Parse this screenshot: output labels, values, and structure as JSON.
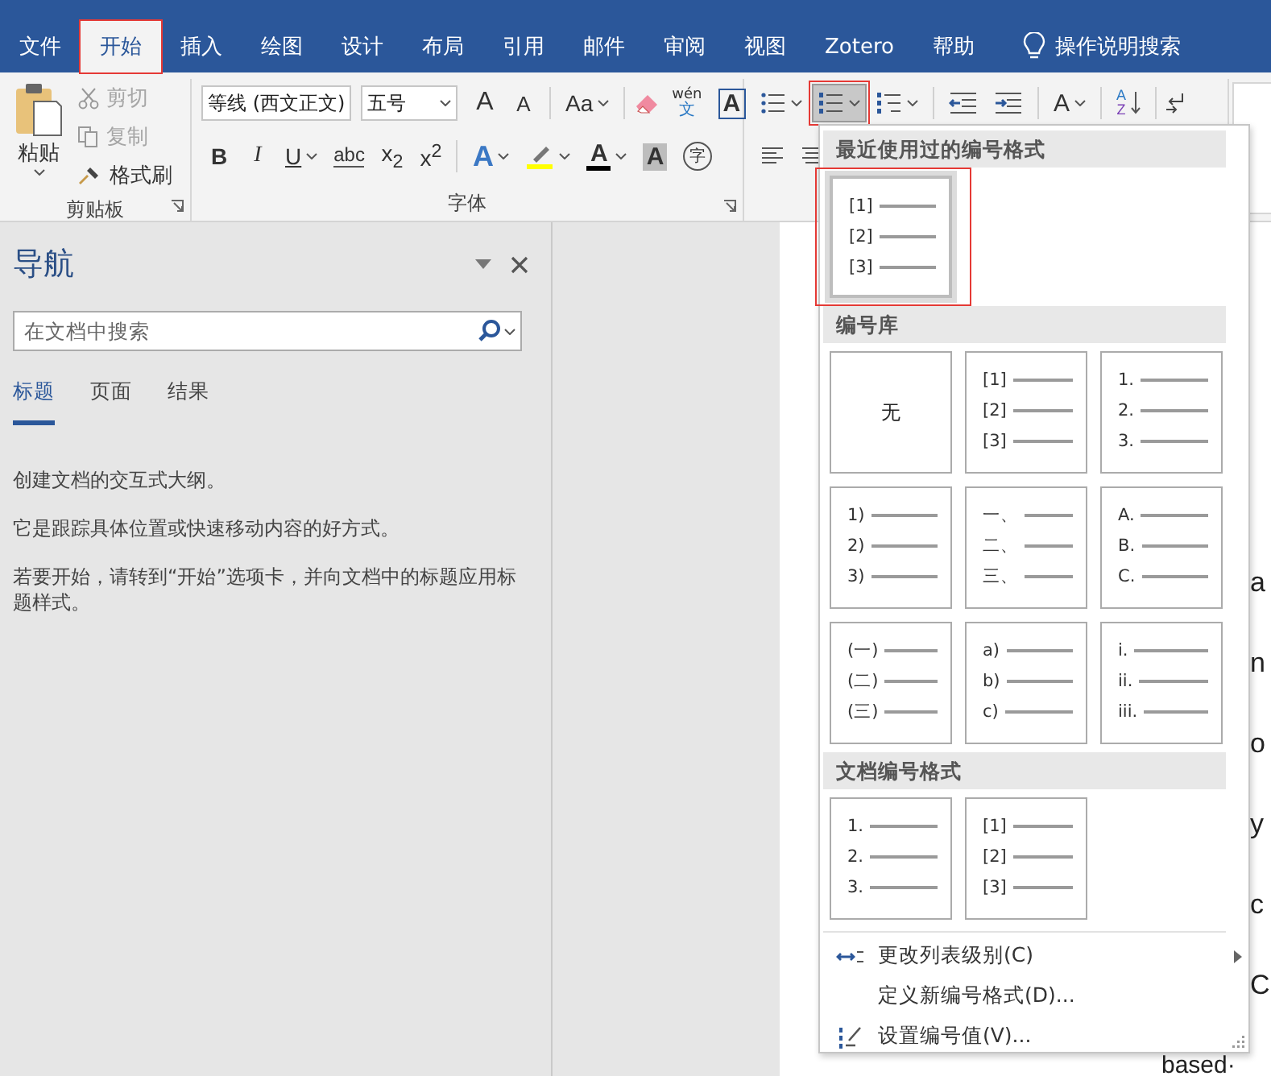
{
  "tabs": [
    {
      "label": "文件",
      "selected": false,
      "highlighted": false
    },
    {
      "label": "开始",
      "selected": true,
      "highlighted": true
    },
    {
      "label": "插入",
      "selected": false,
      "highlighted": false
    },
    {
      "label": "绘图",
      "selected": false,
      "highlighted": false
    },
    {
      "label": "设计",
      "selected": false,
      "highlighted": false
    },
    {
      "label": "布局",
      "selected": false,
      "highlighted": false
    },
    {
      "label": "引用",
      "selected": false,
      "highlighted": false
    },
    {
      "label": "邮件",
      "selected": false,
      "highlighted": false
    },
    {
      "label": "审阅",
      "selected": false,
      "highlighted": false
    },
    {
      "label": "视图",
      "selected": false,
      "highlighted": false
    },
    {
      "label": "Zotero",
      "selected": false,
      "highlighted": false
    },
    {
      "label": "帮助",
      "selected": false,
      "highlighted": false
    }
  ],
  "tell_me": "操作说明搜索",
  "clipboard": {
    "paste": "粘贴",
    "group_label": "剪贴板",
    "commands": [
      {
        "label": "剪切",
        "disabled": true
      },
      {
        "label": "复制",
        "disabled": true
      },
      {
        "label": "格式刷",
        "disabled": false
      }
    ]
  },
  "font": {
    "face": "等线 (西文正文)",
    "size": "五号",
    "grow": "A",
    "shrink": "A",
    "change_case": "Aa",
    "phonetic_top": "wén",
    "phonetic_bottom": "文",
    "char_border": "A",
    "format_buttons": [
      {
        "label": "B",
        "kind": "bold"
      },
      {
        "label": "I",
        "kind": "italic"
      },
      {
        "label": "U",
        "kind": "underline"
      },
      {
        "label": "abc",
        "kind": "strike"
      },
      {
        "label": "x$_{2}$",
        "kind": "plain"
      },
      {
        "label": "x$^{2}$",
        "kind": "plain"
      }
    ],
    "text_effects": "A",
    "font_color": "A",
    "char_shading": "A",
    "enclose_char": "字",
    "group_label": "字体"
  },
  "paragraph": {
    "numbering_pressed": true,
    "numbering_highlighted": true,
    "asian_layout": "A",
    "sort_top": "A",
    "sort_bottom": "Z"
  },
  "navigation": {
    "title": "导航",
    "search_placeholder": "在文档中搜索",
    "tabs": [
      {
        "label": "标题",
        "selected": true
      },
      {
        "label": "页面",
        "selected": false
      },
      {
        "label": "结果",
        "selected": false
      }
    ],
    "paragraphs": [
      "创建文档的交互式大纲。",
      "它是跟踪具体位置或快速移动内容的好方式。",
      "若要开始，请转到“开始”选项卡，并向文档中的标题应用标题样式。"
    ]
  },
  "document_lines": [
    {
      "text": "a",
      "kind": "fragment"
    },
    {
      "text": "n",
      "kind": "fragment"
    },
    {
      "text": "o",
      "kind": "fragment"
    },
    {
      "text": "y",
      "kind": "fragment"
    },
    {
      "text": "c",
      "kind": "fragment"
    },
    {
      "text": "C",
      "kind": "fragment"
    },
    {
      "text": "based·",
      "kind": "line"
    }
  ],
  "numbering_menu": {
    "sections": [
      {
        "heading": "最近使用过的编号格式",
        "highlighted": true,
        "items": [
          {
            "kind": "list",
            "selected": true,
            "markers": [
              "[1]",
              "[2]",
              "[3]"
            ]
          }
        ]
      },
      {
        "heading": "编号库",
        "highlighted": false,
        "items": [
          {
            "kind": "none",
            "selected": false,
            "label": "无"
          },
          {
            "kind": "list",
            "selected": false,
            "markers": [
              "[1]",
              "[2]",
              "[3]"
            ]
          },
          {
            "kind": "list",
            "selected": false,
            "markers": [
              "1.",
              "2.",
              "3."
            ]
          },
          {
            "kind": "list",
            "selected": false,
            "markers": [
              "1)",
              "2)",
              "3)"
            ]
          },
          {
            "kind": "list",
            "selected": false,
            "markers": [
              "一、",
              "二、",
              "三、"
            ]
          },
          {
            "kind": "list",
            "selected": false,
            "markers": [
              "A.",
              "B.",
              "C."
            ]
          },
          {
            "kind": "list",
            "selected": false,
            "markers": [
              "(一)",
              "(二)",
              "(三)"
            ]
          },
          {
            "kind": "list",
            "selected": false,
            "markers": [
              "a)",
              "b)",
              "c)"
            ]
          },
          {
            "kind": "list",
            "selected": false,
            "markers": [
              "i.",
              "ii.",
              "iii."
            ]
          }
        ]
      },
      {
        "heading": "文档编号格式",
        "highlighted": false,
        "items": [
          {
            "kind": "list",
            "selected": false,
            "markers": [
              "1.",
              "2.",
              "3."
            ]
          },
          {
            "kind": "list",
            "selected": false,
            "markers": [
              "[1]",
              "[2]",
              "[3]"
            ]
          }
        ]
      }
    ],
    "commands": [
      {
        "label": "更改列表级别(C)",
        "kind": "level"
      },
      {
        "label": "定义新编号格式(D)...",
        "kind": "plain"
      },
      {
        "label": "设置编号值(V)...",
        "kind": "value"
      }
    ]
  }
}
